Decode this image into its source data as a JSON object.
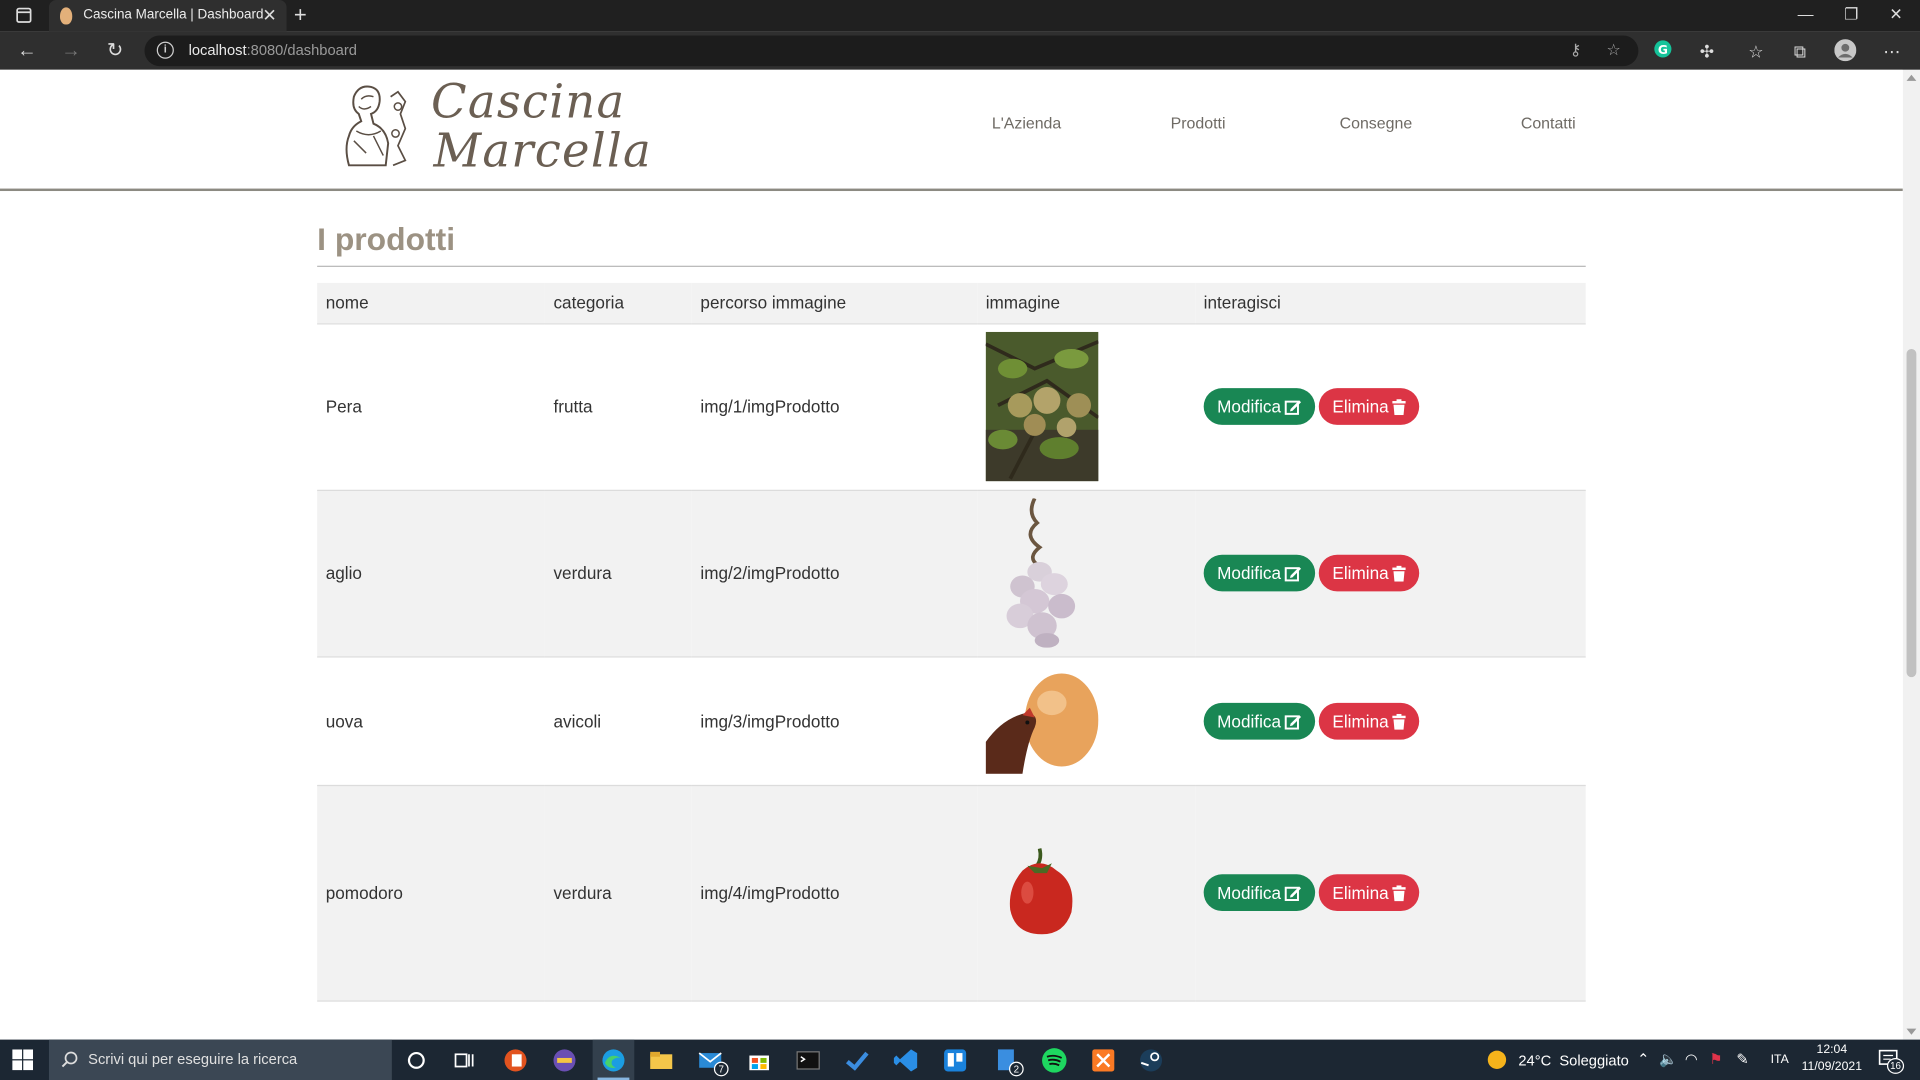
{
  "browser": {
    "tab_title": "Cascina Marcella | Dashboard",
    "url_host": "localhost",
    "url_rest": ":8080/dashboard"
  },
  "site": {
    "logo_line1": "Cascina",
    "logo_line2": "Marcella",
    "nav": [
      {
        "label": "L'Azienda"
      },
      {
        "label": "Prodotti"
      },
      {
        "label": "Consegne"
      },
      {
        "label": "Contatti"
      }
    ]
  },
  "main": {
    "title": "I prodotti",
    "columns": [
      "nome",
      "categoria",
      "percorso immagine",
      "immagine",
      "interagisci"
    ],
    "rows": [
      {
        "nome": "Pera",
        "categoria": "frutta",
        "percorso": "img/1/imgProdotto",
        "image_icon": "pear-tree-photo"
      },
      {
        "nome": "aglio",
        "categoria": "verdura",
        "percorso": "img/2/imgProdotto",
        "image_icon": "garlic-bunch-photo"
      },
      {
        "nome": "uova",
        "categoria": "avicoli",
        "percorso": "img/3/imgProdotto",
        "image_icon": "hen-egg-photo"
      },
      {
        "nome": "pomodoro",
        "categoria": "verdura",
        "percorso": "img/4/imgProdotto",
        "image_icon": "tomato-photo"
      }
    ],
    "edit_label": "Modifica",
    "delete_label": "Elimina"
  },
  "taskbar": {
    "search_placeholder": "Scrivi qui per eseguire la ricerca",
    "weather": "24°C  Soleggiato",
    "language": "ITA",
    "time": "12:04",
    "date": "11/09/2021",
    "notifications": "16",
    "mail_badge": "7",
    "app_badge": "2"
  },
  "colors": {
    "edit_button": "#198754",
    "delete_button": "#dc3545",
    "title": "#9c9283"
  }
}
